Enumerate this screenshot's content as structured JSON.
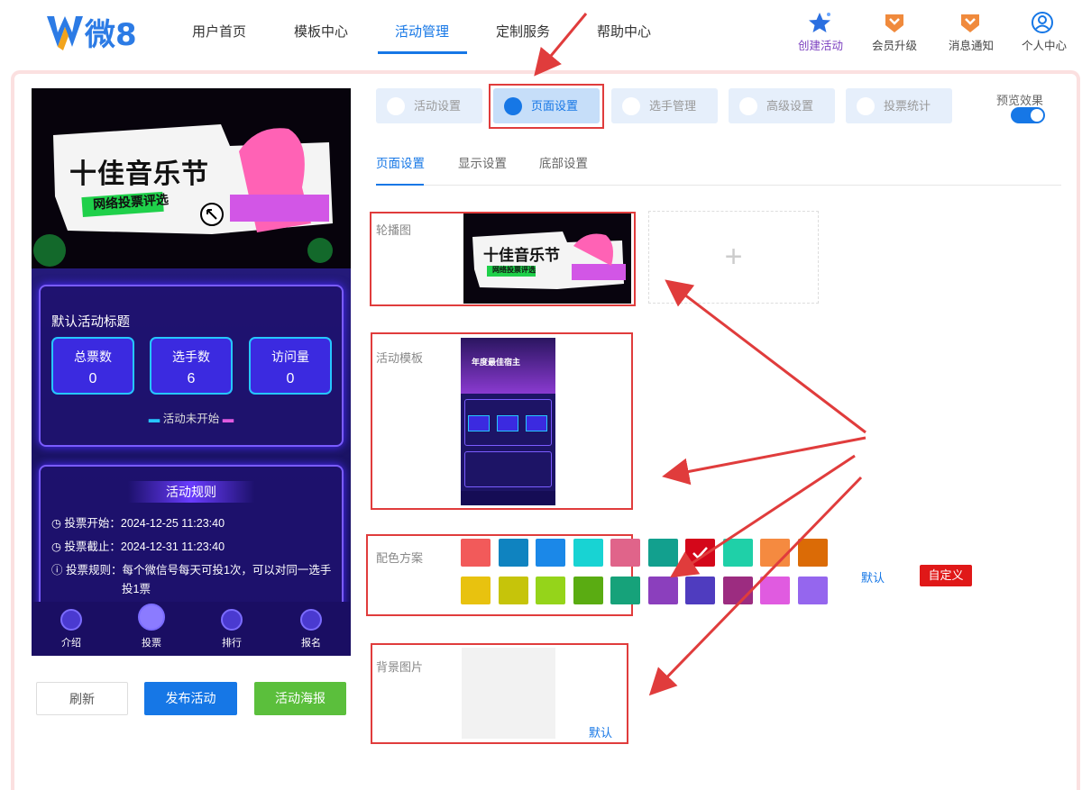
{
  "logo": {
    "text": "微8"
  },
  "nav": [
    "用户首页",
    "模板中心",
    "活动管理",
    "定制服务",
    "帮助中心"
  ],
  "topicons": [
    {
      "label": "创建活动",
      "icon": "star-icon",
      "color": "#7b3fbf"
    },
    {
      "label": "会员升级",
      "icon": "vip-icon",
      "color": "#444"
    },
    {
      "label": "消息通知",
      "icon": "bell-icon",
      "color": "#444"
    },
    {
      "label": "个人中心",
      "icon": "user-icon",
      "color": "#444"
    }
  ],
  "phone": {
    "banner_title": "十佳音乐节",
    "banner_sub": "网络投票评选",
    "card_title": "默认活动标题",
    "stats": [
      {
        "label": "总票数",
        "value": "0"
      },
      {
        "label": "选手数",
        "value": "6"
      },
      {
        "label": "访问量",
        "value": "0"
      }
    ],
    "status": "活动未开始",
    "rules_title": "活动规则",
    "rules": [
      "投票开始：2024-12-25 11:23:40",
      "投票截止：2024-12-31 11:23:40",
      "投票规则：每个微信号每天可投1次，可以对同一选手",
      "投1票"
    ],
    "tabs": [
      "介绍",
      "投票",
      "排行",
      "报名"
    ]
  },
  "buttons": {
    "refresh": "刷新",
    "publish": "发布活动",
    "poster": "活动海报"
  },
  "tabs": [
    "活动设置",
    "页面设置",
    "选手管理",
    "高级设置",
    "投票统计"
  ],
  "preview": "预览效果",
  "subtabs": [
    "页面设置",
    "显示设置",
    "底部设置"
  ],
  "form": {
    "carousel": "轮播图",
    "template": "活动模板",
    "template_title": "年度最佳宿主",
    "colors": "配色方案",
    "bg": "背景图片",
    "default": "默认",
    "custom": "自定义"
  },
  "swatches": [
    "#f25a5a",
    "#0f83c0",
    "#1b88e8",
    "#18d3d3",
    "#e0648a",
    "#12a08e",
    "#d4071a",
    "#1fd0a8",
    "#f58a40",
    "#db6b06",
    "#e8c20f",
    "#c6c40a",
    "#95d41a",
    "#5aac12",
    "#16a27a",
    "#8b3fbd",
    "#4f3cbf",
    "#9c2c80",
    "#e05be0",
    "#9566ee"
  ],
  "accent": "#1677e6"
}
